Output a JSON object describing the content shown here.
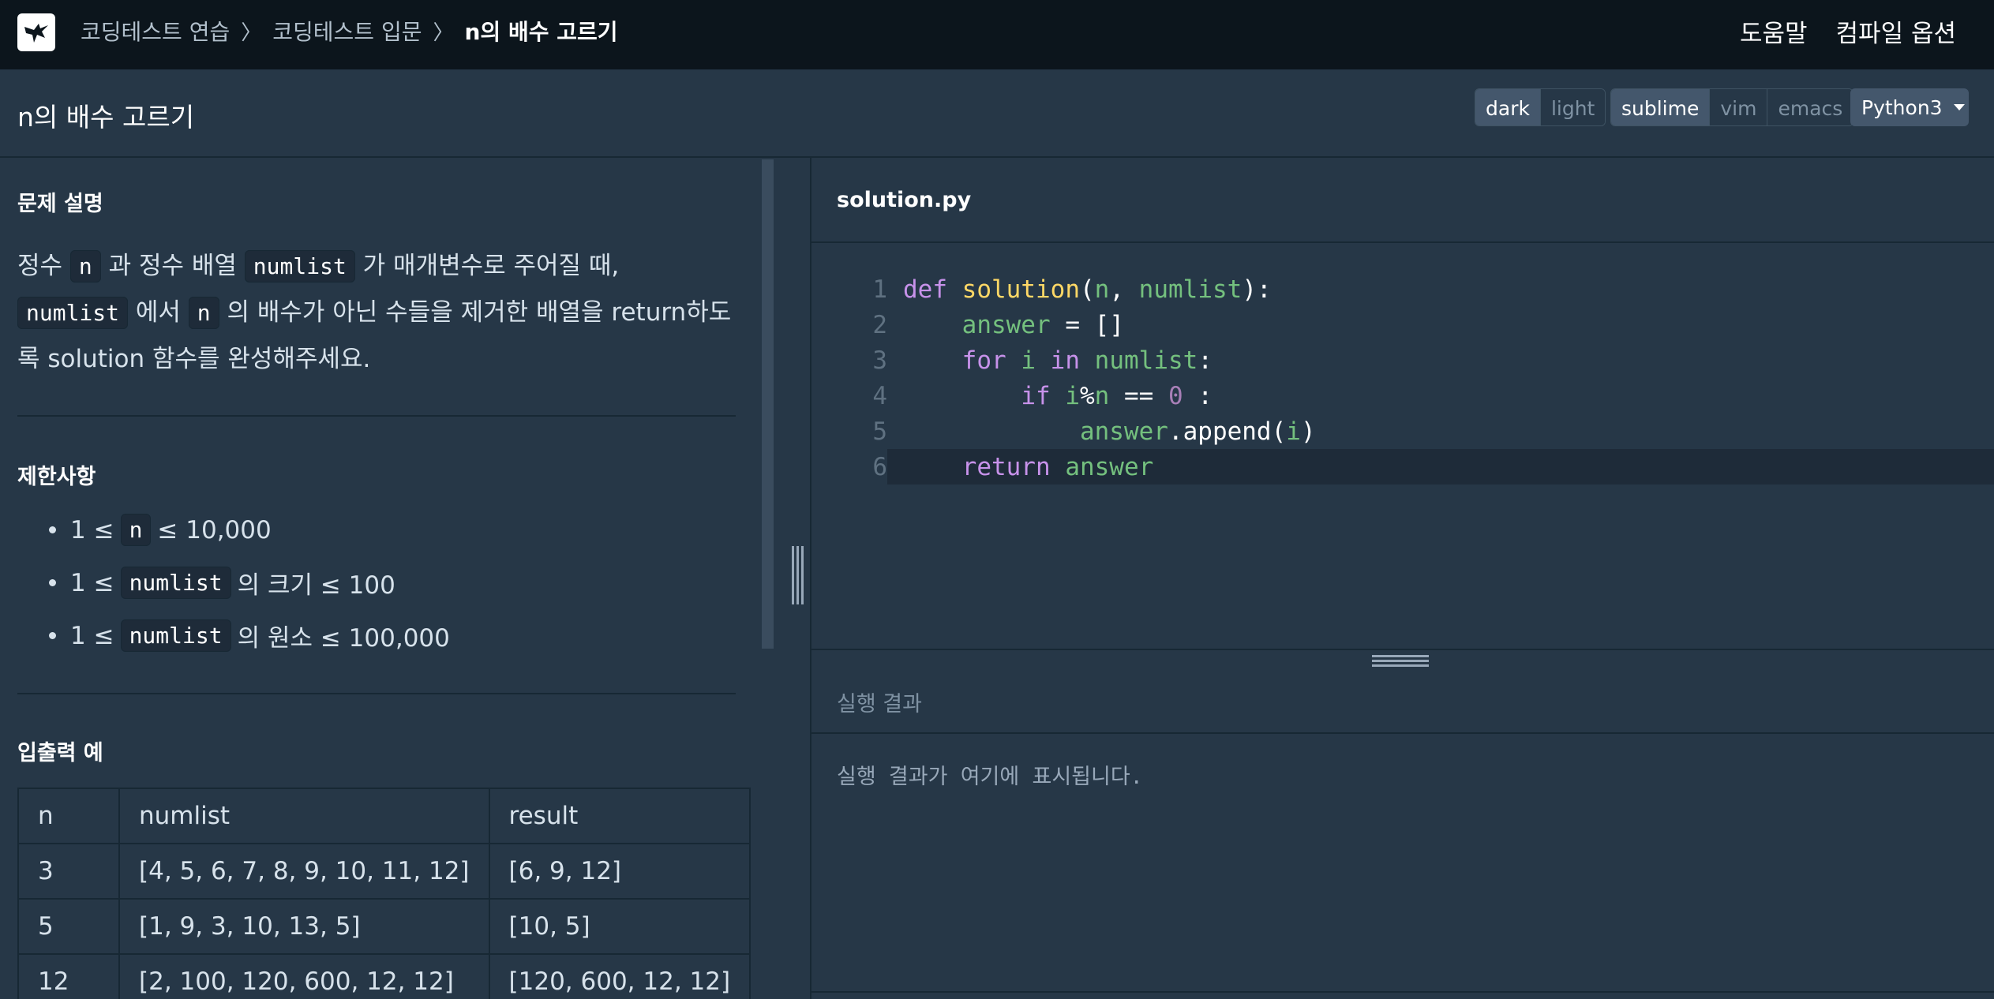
{
  "nav": {
    "breadcrumbs": [
      "코딩테스트 연습",
      "코딩테스트 입문",
      "n의 배수 고르기"
    ],
    "help": "도움말",
    "compile_options": "컴파일 옵션"
  },
  "header": {
    "title": "n의 배수 고르기",
    "theme": {
      "dark": "dark",
      "light": "light",
      "selected": "dark"
    },
    "keymap": {
      "sublime": "sublime",
      "vim": "vim",
      "emacs": "emacs",
      "selected": "sublime"
    },
    "language": "Python3"
  },
  "problem": {
    "desc_title": "문제 설명",
    "desc": {
      "p1": "정수",
      "c1": "n",
      "p2": "과 정수 배열",
      "c2": "numlist",
      "p3": "가 매개변수로 주어질 때,",
      "c3": "numlist",
      "p4": "에서",
      "c4": "n",
      "p5": "의 배수가 아닌 수들을 제거한 배열을 return하도록 solution 함수를 완성해주세요."
    },
    "limits_title": "제한사항",
    "limits": [
      {
        "pre": "1 ≤",
        "code": "n",
        "post": "≤ 10,000"
      },
      {
        "pre": "1 ≤",
        "code": "numlist",
        "post": "의 크기 ≤ 100"
      },
      {
        "pre": "1 ≤",
        "code": "numlist",
        "post": "의 원소 ≤ 100,000"
      }
    ],
    "io_title": "입출력 예",
    "io_headers": [
      "n",
      "numlist",
      "result"
    ],
    "io_rows": [
      [
        "3",
        "[4, 5, 6, 7, 8, 9, 10, 11, 12]",
        "[6, 9, 12]"
      ],
      [
        "5",
        "[1, 9, 3, 10, 13, 5]",
        "[10, 5]"
      ],
      [
        "12",
        "[2, 100, 120, 600, 12, 12]",
        "[120, 600, 12, 12]"
      ]
    ]
  },
  "editor": {
    "filename": "solution.py",
    "line_numbers": [
      "1",
      "2",
      "3",
      "4",
      "5",
      "6"
    ],
    "active_line": 6
  },
  "result": {
    "title": "실행 결과",
    "message": "실행 결과가 여기에 표시됩니다."
  }
}
